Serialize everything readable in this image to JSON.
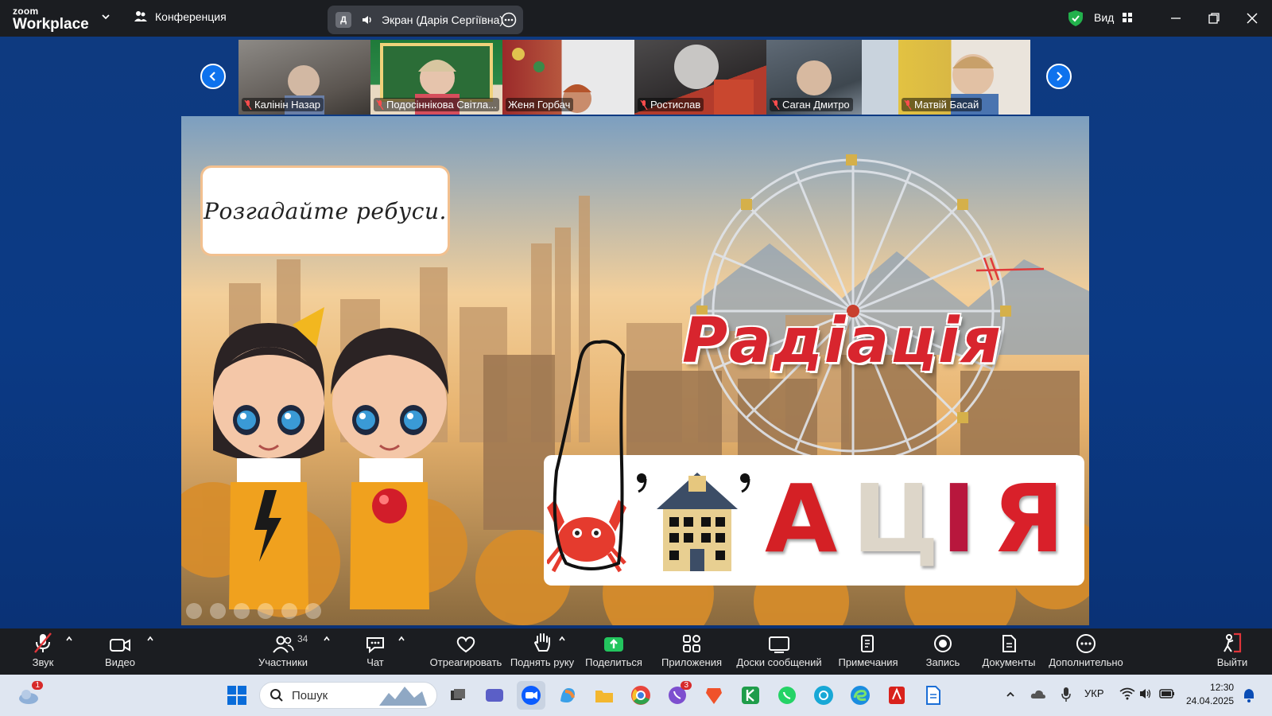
{
  "topbar": {
    "logo_line1": "zoom",
    "logo_line2": "Workplace",
    "conference_label": "Конференция",
    "screen_share": {
      "avatar_letter": "Д",
      "title": "Экран (Дарія Сергіївна)"
    },
    "view_label": "Вид"
  },
  "participants": [
    {
      "name": "Калінін Назар",
      "muted": true
    },
    {
      "name": "Подосіннікова Світла...",
      "muted": true
    },
    {
      "name": "Женя Горбач",
      "muted": false
    },
    {
      "name": "Ростислав",
      "muted": true
    },
    {
      "name": "Саган Дмитро",
      "muted": true
    },
    {
      "name": "Матвій Басай",
      "muted": true
    }
  ],
  "slide": {
    "task": "Розгадайте ребуси.",
    "word": "Радіація",
    "rebus_letters": [
      "А",
      "Ц",
      "І",
      "Я"
    ],
    "rebus_colors": [
      "#d42025",
      "#ddd6c9",
      "#b8173d",
      "#d9202a"
    ]
  },
  "toolbar": {
    "audio": "Звук",
    "video": "Видео",
    "participants": "Участники",
    "participants_count": "34",
    "chat": "Чат",
    "react": "Отреагировать",
    "raise_hand": "Поднять руку",
    "share": "Поделиться",
    "apps": "Приложения",
    "whiteboards": "Доски сообщений",
    "notes": "Примечания",
    "record": "Запись",
    "docs": "Документы",
    "more": "Дополнительно",
    "leave": "Выйти"
  },
  "taskbar": {
    "weather_badge": "1",
    "search_placeholder": "Пошук",
    "viber_badge": "3",
    "language": "УКР",
    "time": "12:30",
    "date": "24.04.2025"
  }
}
